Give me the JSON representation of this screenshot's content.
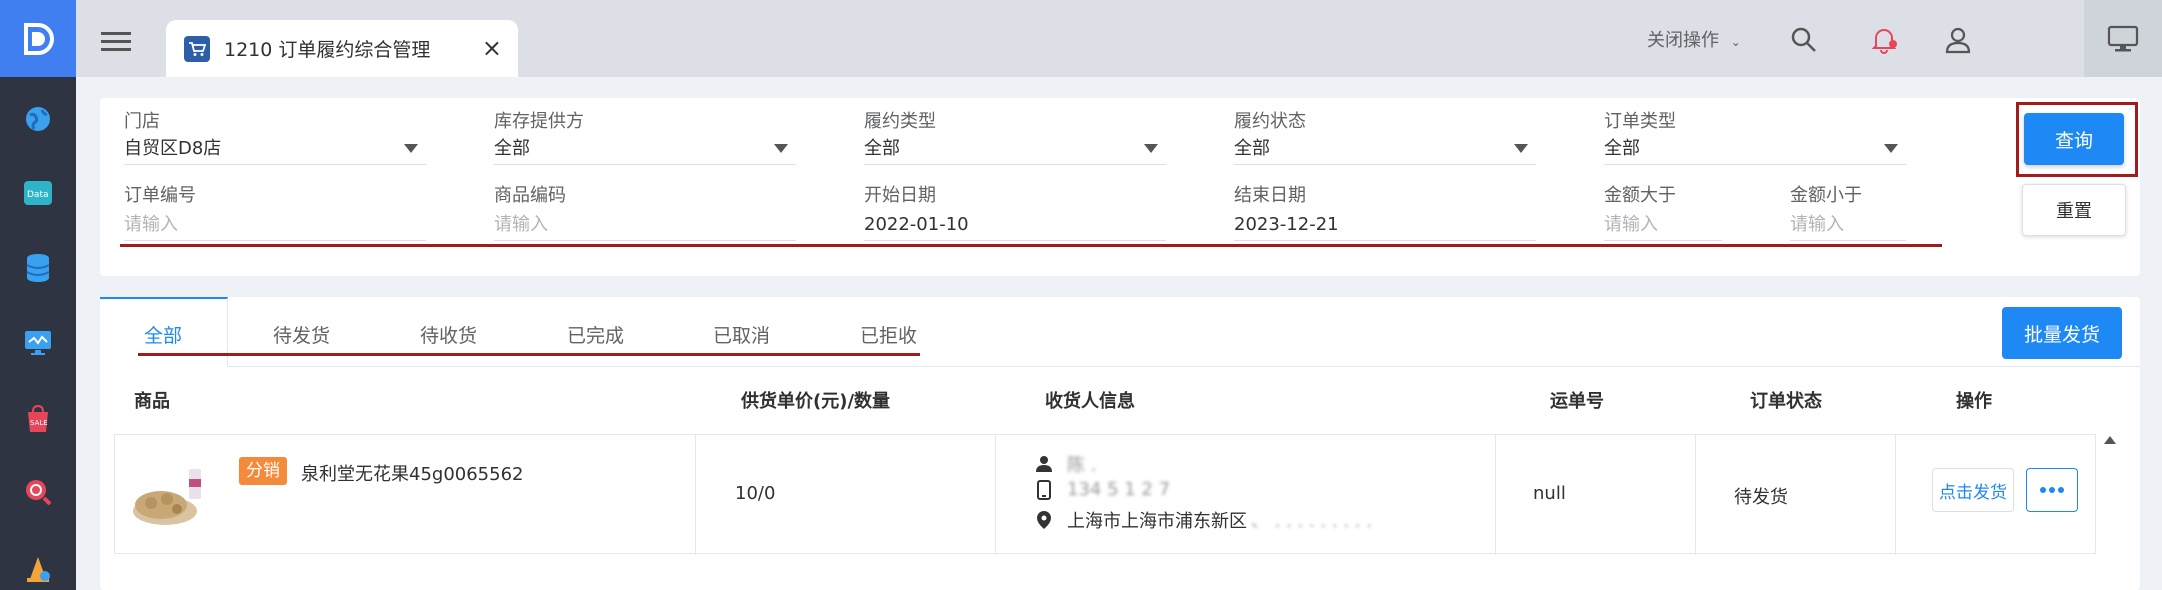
{
  "tab": {
    "title": "1210 订单履约综合管理",
    "close": "×"
  },
  "header": {
    "close_ops": "关闭操作"
  },
  "filters": {
    "store": {
      "label": "门店",
      "value": "自贸区D8店"
    },
    "supplier": {
      "label": "库存提供方",
      "value": "全部"
    },
    "fulfill_type": {
      "label": "履约类型",
      "value": "全部"
    },
    "fulfill_status": {
      "label": "履约状态",
      "value": "全部"
    },
    "order_type": {
      "label": "订单类型",
      "value": "全部"
    },
    "order_no": {
      "label": "订单编号",
      "placeholder": "请输入"
    },
    "sku": {
      "label": "商品编码",
      "placeholder": "请输入"
    },
    "start_date": {
      "label": "开始日期",
      "value": "2022-01-10"
    },
    "end_date": {
      "label": "结束日期",
      "value": "2023-12-21"
    },
    "amount_min": {
      "label": "金额大于",
      "placeholder": "请输入"
    },
    "amount_max": {
      "label": "金额小于",
      "placeholder": "请输入"
    },
    "query_label": "查询",
    "reset_label": "重置"
  },
  "order_tabs": [
    "全部",
    "待发货",
    "待收货",
    "已完成",
    "已取消",
    "已拒收"
  ],
  "batch_ship_label": "批量发货",
  "table": {
    "headers": [
      "商品",
      "供货单价(元)/数量",
      "收货人信息",
      "运单号",
      "订单状态",
      "操作"
    ],
    "rows": [
      {
        "badge": "分销",
        "product": "泉利堂无花果45g0065562",
        "price_qty": "10/0",
        "recipient_name": "陈 .",
        "recipient_phone": "134 5 1 2 7",
        "recipient_address": "上海市上海市浦东新区",
        "waybill": "null",
        "status": "待发货",
        "ship_label": "点击发货"
      }
    ]
  },
  "colors": {
    "primary": "#1e88f5",
    "sidebar": "#2f3442",
    "logo": "#3f7ff0",
    "badge": "#f58a3a",
    "annotation": "#a31b1b"
  }
}
